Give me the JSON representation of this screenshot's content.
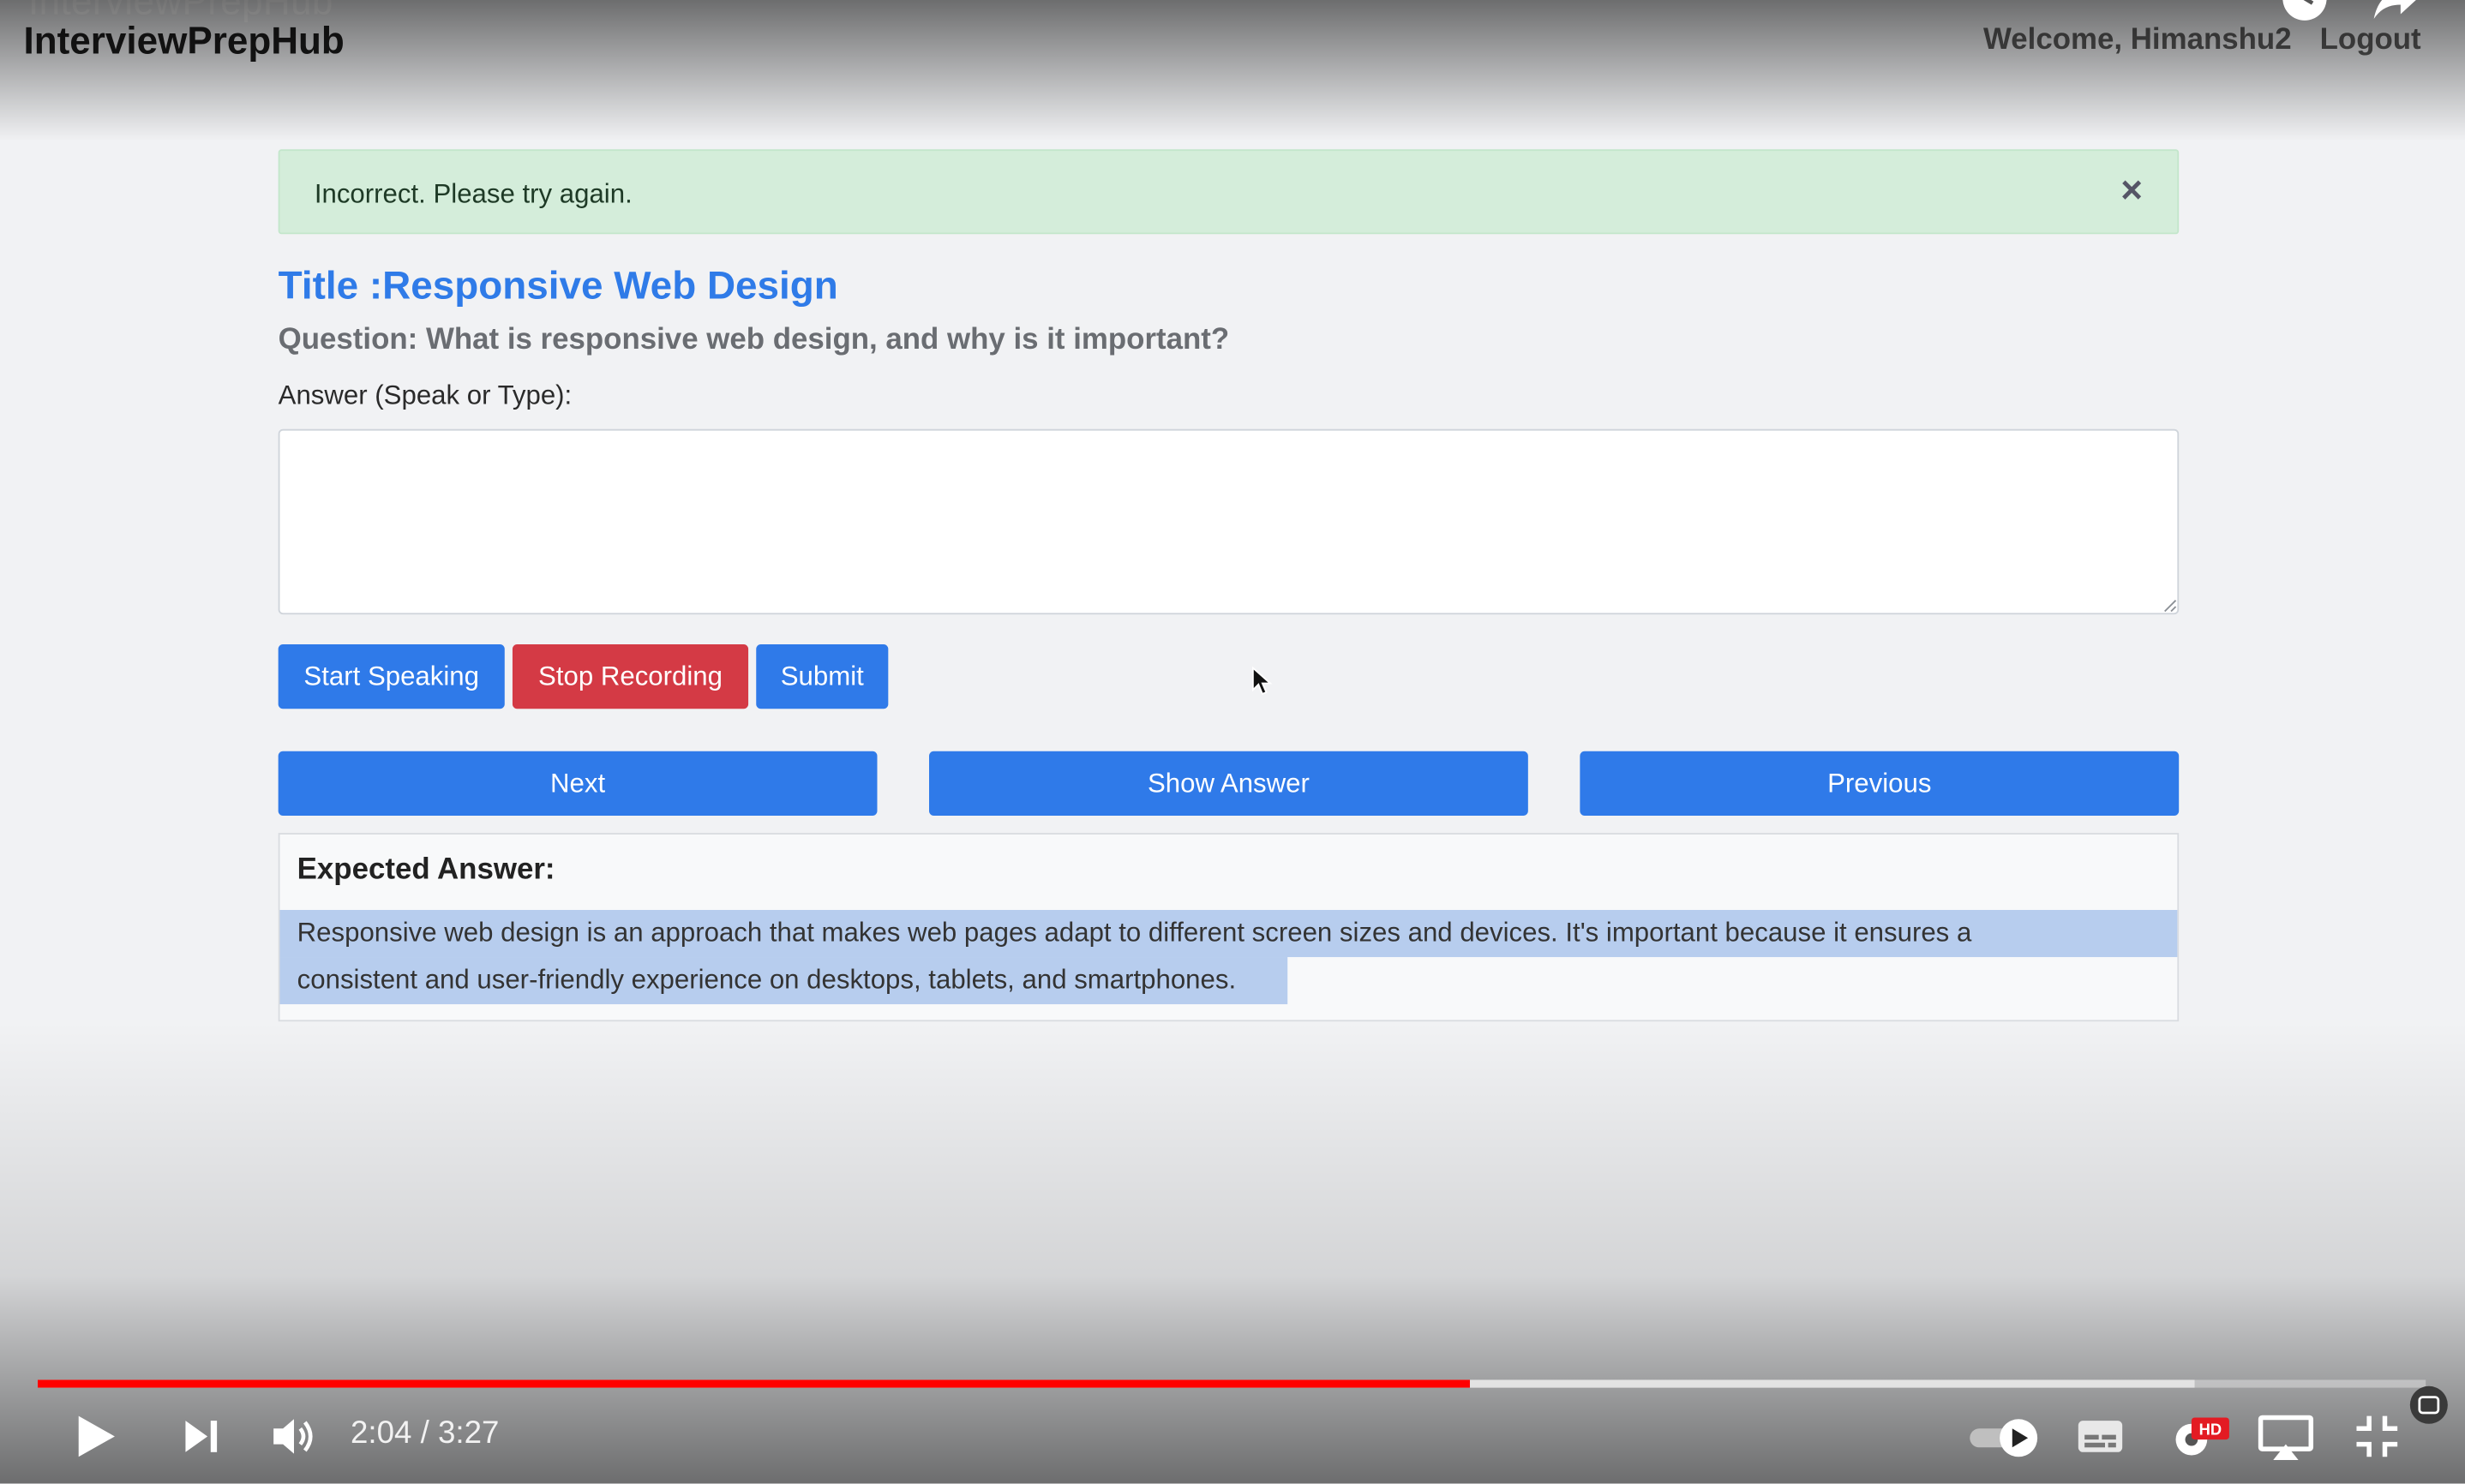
{
  "app": {
    "brand_ghost": "InterviewPrepHub",
    "brand": "InterviewPrepHub",
    "welcome": "Welcome, Himanshu2",
    "logout": "Logout"
  },
  "alert": {
    "message": "Incorrect. Please try again.",
    "close_glyph": "×"
  },
  "question": {
    "title": "Title :Responsive Web Design",
    "text": "Question: What is responsive web design, and why is it important?",
    "answer_label": "Answer (Speak or Type):",
    "answer_value": ""
  },
  "buttons": {
    "start": "Start Speaking",
    "stop": "Stop Recording",
    "submit": "Submit",
    "next": "Next",
    "show_answer": "Show Answer",
    "previous": "Previous"
  },
  "expected": {
    "heading": "Expected Answer:",
    "line1": "Responsive web design is an approach that makes web pages adapt to different screen sizes and devices. It's important because it ensures a",
    "line2": "consistent and user-friendly experience on desktops, tablets, and smartphones."
  },
  "player": {
    "time": "2:04 / 3:27",
    "played_fraction": 0.6,
    "buffered_fraction": 0.903,
    "hd_badge": "HD",
    "icons": [
      "play-icon",
      "next-icon",
      "volume-icon",
      "autoplay-toggle-icon",
      "subtitles-icon",
      "settings-icon",
      "airplay-icon",
      "exit-fullscreen-icon",
      "clock-icon",
      "share-icon"
    ]
  },
  "colors": {
    "primary": "#2f7ae9",
    "danger": "#d43a45",
    "alert_bg": "#d4edda",
    "title": "#2f7be8",
    "progress": "#ff0000",
    "highlight": "#b7cdee"
  }
}
